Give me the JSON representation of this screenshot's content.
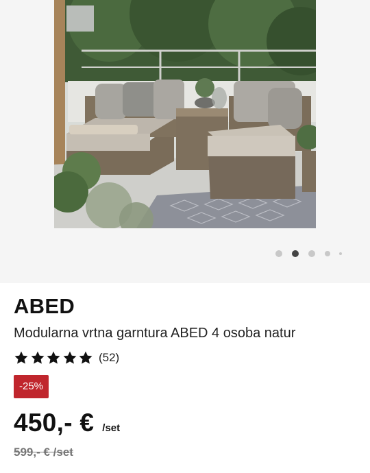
{
  "product": {
    "image_alt": "Garden lounge set ABED on terrace",
    "brand": "ABED",
    "description": "Modularna vrtna garntura ABED 4 osoba natur",
    "rating": {
      "stars": 5,
      "count_label": "(52)"
    },
    "discount_label": "-25%",
    "price": "450,- €",
    "price_unit": "/set",
    "old_price": "599,- € /set"
  },
  "gallery": {
    "slide_count": 5,
    "active_slide": 2
  },
  "colors": {
    "badge": "#c0262d",
    "text": "#111111",
    "old_price": "#777777",
    "dot_active": "#444444",
    "dot_inactive": "#c8c8c8"
  }
}
